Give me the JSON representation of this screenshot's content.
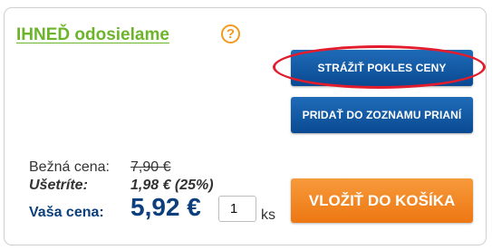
{
  "shipping": {
    "label": "IHNEĎ odosielame",
    "help_icon": "?"
  },
  "buttons": {
    "watch_price": "STRÁŽIŤ POKLES CENY",
    "wishlist": "PRIDAŤ DO ZOZNAMU PRIANÍ",
    "add_to_cart": "VLOŽIŤ DO KOŠÍKA"
  },
  "pricing": {
    "regular_label": "Bežná cena:",
    "regular_value": "7,90 €",
    "save_label": "Ušetríte:",
    "save_value": "1,98 € (25%)",
    "your_label": "Vaša cena:",
    "your_value": "5,92 €"
  },
  "quantity": {
    "value": "1",
    "unit": "ks"
  },
  "colors": {
    "shipping_green": "#6cb52b",
    "button_blue": "#0a4a92",
    "cart_orange": "#ed7712",
    "highlight_red": "#e21c2c",
    "price_blue": "#0c3f7c"
  }
}
